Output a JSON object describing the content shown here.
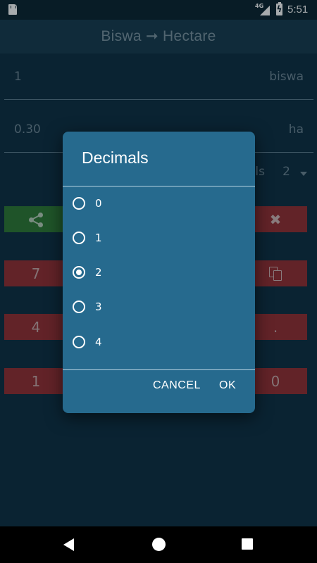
{
  "status_bar": {
    "network": "4G",
    "time": "5:51"
  },
  "app_bar": {
    "title": "Biswa ➞ Hectare"
  },
  "converter": {
    "input_value": "1",
    "input_unit": "biswa",
    "output_value": "0.30",
    "output_unit": "ha",
    "decimals_label": "ls",
    "decimals_value": "2"
  },
  "keypad": {
    "row2_left": "7",
    "row3_left": "4",
    "row3_right": ".",
    "row4_left": "1",
    "row4_right": "0"
  },
  "dialog": {
    "title": "Decimals",
    "options": [
      "0",
      "1",
      "2",
      "3",
      "4"
    ],
    "selected": "2",
    "cancel_label": "CANCEL",
    "ok_label": "OK"
  },
  "colors": {
    "dialog_bg": "#266a8e",
    "key_red": "#962f34",
    "key_green": "#2f7a35"
  }
}
